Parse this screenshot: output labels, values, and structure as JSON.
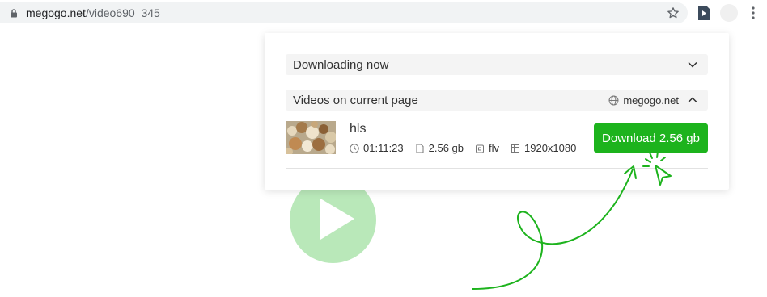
{
  "browser": {
    "url_domain": "megogo.net",
    "url_path": "/video690_345",
    "icons": [
      "lock-icon",
      "star-icon",
      "extension-icon",
      "profile-avatar",
      "kebab-menu-icon"
    ]
  },
  "popup": {
    "downloading_now": {
      "label": "Downloading now",
      "state": "collapsed"
    },
    "videos_section": {
      "label": "Videos on current page",
      "site": "megogo.net",
      "state": "expanded"
    },
    "video": {
      "title": "hls",
      "duration": "01:11:23",
      "size": "2.56 gb",
      "format": "flv",
      "resolution": "1920x1080",
      "download_label": "Download 2.56 gb"
    }
  },
  "colors": {
    "accent": "#1db31d",
    "play_button": "#b9e8b9",
    "annotation": "#1db31d"
  }
}
